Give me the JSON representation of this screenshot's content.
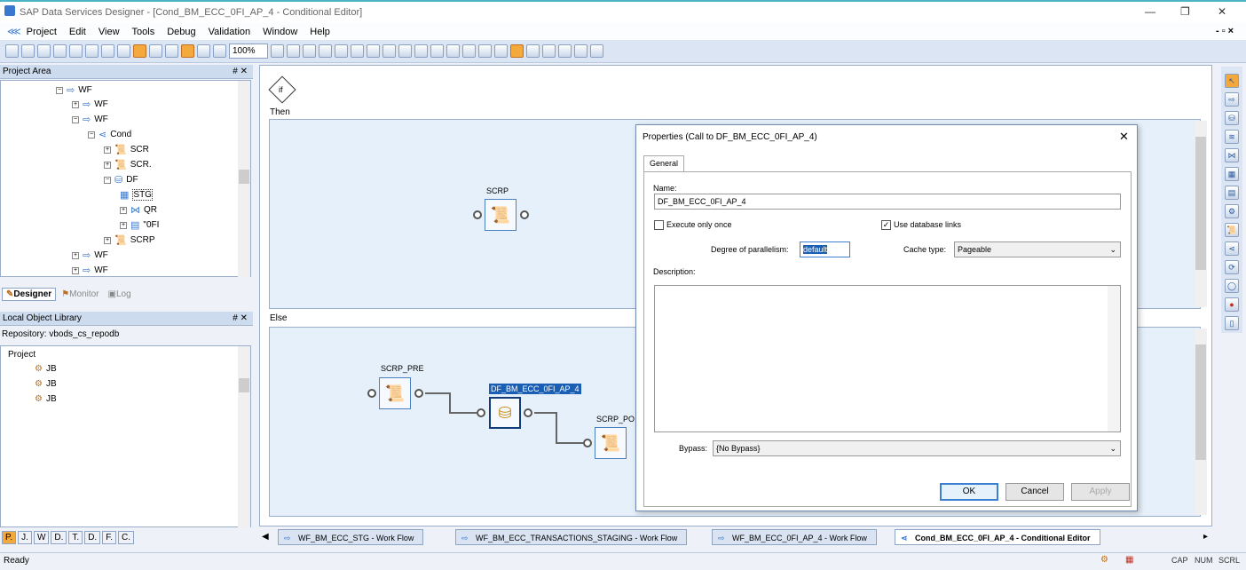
{
  "window": {
    "title": "SAP Data Services Designer - [Cond_BM_ECC_0FI_AP_4 - Conditional Editor]",
    "min": "—",
    "max": "❐",
    "close": "✕",
    "mdi_controls": "- ▫ ×"
  },
  "menu": [
    "Project",
    "Edit",
    "View",
    "Tools",
    "Debug",
    "Validation",
    "Window",
    "Help"
  ],
  "toolbar": {
    "zoom": "100%"
  },
  "project_area": {
    "title": "Project Area",
    "pin": "# ✕",
    "tree": [
      {
        "label": "WF",
        "icon": "arrow-icon"
      },
      {
        "label": "WF",
        "icon": "arrow-icon"
      },
      {
        "label": "WF",
        "icon": "arrow-icon"
      },
      {
        "label": "Cond",
        "icon": "conditional-icon"
      },
      {
        "label": "SCR",
        "icon": "script-icon"
      },
      {
        "label": "SCR.",
        "icon": "script-icon"
      },
      {
        "label": "DF",
        "icon": "dataflow-icon"
      },
      {
        "label": "STG",
        "icon": "table-icon"
      },
      {
        "label": "QR",
        "icon": "query-icon"
      },
      {
        "label": "\"0FI",
        "icon": "template-icon"
      },
      {
        "label": "SCRP",
        "icon": "script-icon"
      },
      {
        "label": "WF",
        "icon": "arrow-icon"
      },
      {
        "label": "WF",
        "icon": "arrow-icon"
      }
    ],
    "tabs": [
      "Designer",
      "Monitor",
      "Log"
    ]
  },
  "local_library": {
    "title": "Local Object Library",
    "pin": "# ✕",
    "repository": "Repository: vbods_cs_repodb",
    "root": "Project",
    "items": [
      "JB",
      "JB",
      "JB"
    ],
    "bottom_tabs": [
      "P.",
      "J.",
      "W",
      "D.",
      "T.",
      "D.",
      "F.",
      "C."
    ]
  },
  "canvas": {
    "if_label": "if",
    "then_label": "Then",
    "else_label": "Else",
    "then_objects": [
      {
        "label": "SCRP"
      }
    ],
    "else_objects": [
      {
        "label": "SCRP_PRE"
      },
      {
        "label": "DF_BM_ECC_0FI_AP_4"
      },
      {
        "label": "SCRP_PO"
      }
    ]
  },
  "dialog": {
    "title": "Properties (Call to DF_BM_ECC_0FI_AP_4)",
    "close": "✕",
    "tab": "General",
    "name_label": "Name:",
    "name_value": "DF_BM_ECC_0FI_AP_4",
    "execute_once_label": "Execute only once",
    "execute_once_checked": false,
    "use_db_links_label": "Use database links",
    "use_db_links_checked": true,
    "parallelism_label": "Degree of parallelism:",
    "parallelism_value": "default",
    "cache_type_label": "Cache type:",
    "cache_type_value": "Pageable",
    "description_label": "Description:",
    "bypass_label": "Bypass:",
    "bypass_value": "{No Bypass}",
    "ok": "OK",
    "cancel": "Cancel",
    "apply": "Apply"
  },
  "doc_tabs": [
    {
      "label": "WF_BM_ECC_STG - Work Flow",
      "active": false
    },
    {
      "label": "WF_BM_ECC_TRANSACTIONS_STAGING - Work Flow",
      "active": false
    },
    {
      "label": "WF_BM_ECC_0FI_AP_4 - Work Flow",
      "active": false
    },
    {
      "label": "Cond_BM_ECC_0FI_AP_4 - Conditional Editor",
      "active": true
    }
  ],
  "status": {
    "text": "Ready",
    "cap": "CAP",
    "num": "NUM",
    "scrl": "SCRL"
  },
  "colors": {
    "accent": "#f4a93c",
    "panel": "#cddbee",
    "selection": "#1a5fb4"
  }
}
